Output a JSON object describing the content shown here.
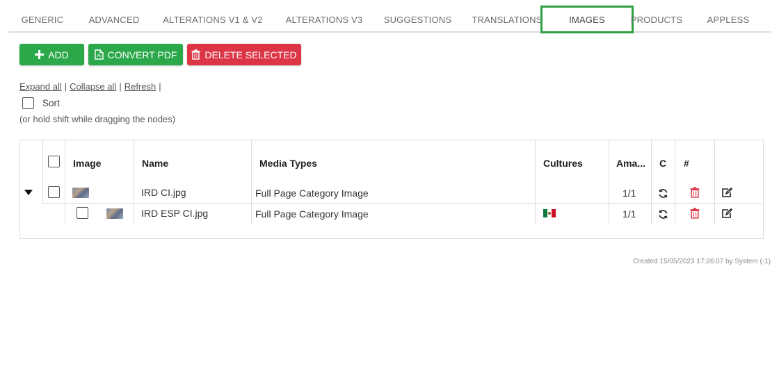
{
  "tabs": [
    {
      "label": "GENERIC"
    },
    {
      "label": "ADVANCED"
    },
    {
      "label": "ALTERATIONS V1 & V2"
    },
    {
      "label": "ALTERATIONS V3"
    },
    {
      "label": "SUGGESTIONS"
    },
    {
      "label": "TRANSLATIONS"
    },
    {
      "label": "IMAGES",
      "active": true
    },
    {
      "label": "PRODUCTS"
    },
    {
      "label": "APPLESS"
    }
  ],
  "toolbar": {
    "add_label": "ADD",
    "convert_label": "CONVERT PDF",
    "delete_label": "DELETE SELECTED"
  },
  "tree_links": {
    "expand_all": "Expand all",
    "collapse_all": "Collapse all",
    "refresh": "Refresh",
    "separator": "|"
  },
  "sort": {
    "label": "Sort",
    "hint": "(or hold shift while dragging the nodes)"
  },
  "table": {
    "headers": {
      "image": "Image",
      "name": "Name",
      "media_types": "Media Types",
      "cultures": "Cultures",
      "amount": "Ama...",
      "c": "C",
      "hash": "#"
    },
    "rows": [
      {
        "name": "IRD CI.jpg",
        "media_type": "Full Page Category Image",
        "culture_flag": "",
        "amount": "1/1"
      },
      {
        "name": "IRD ESP CI.jpg",
        "media_type": "Full Page Category Image",
        "culture_flag": "mexico-flag",
        "amount": "1/1"
      }
    ]
  },
  "footer": {
    "created": "Created 15/05/2023 17:26:07 by System (-1)"
  },
  "colors": {
    "green": "#2aa84a",
    "red": "#dc3545",
    "active_tab_border": "#2ea043"
  }
}
